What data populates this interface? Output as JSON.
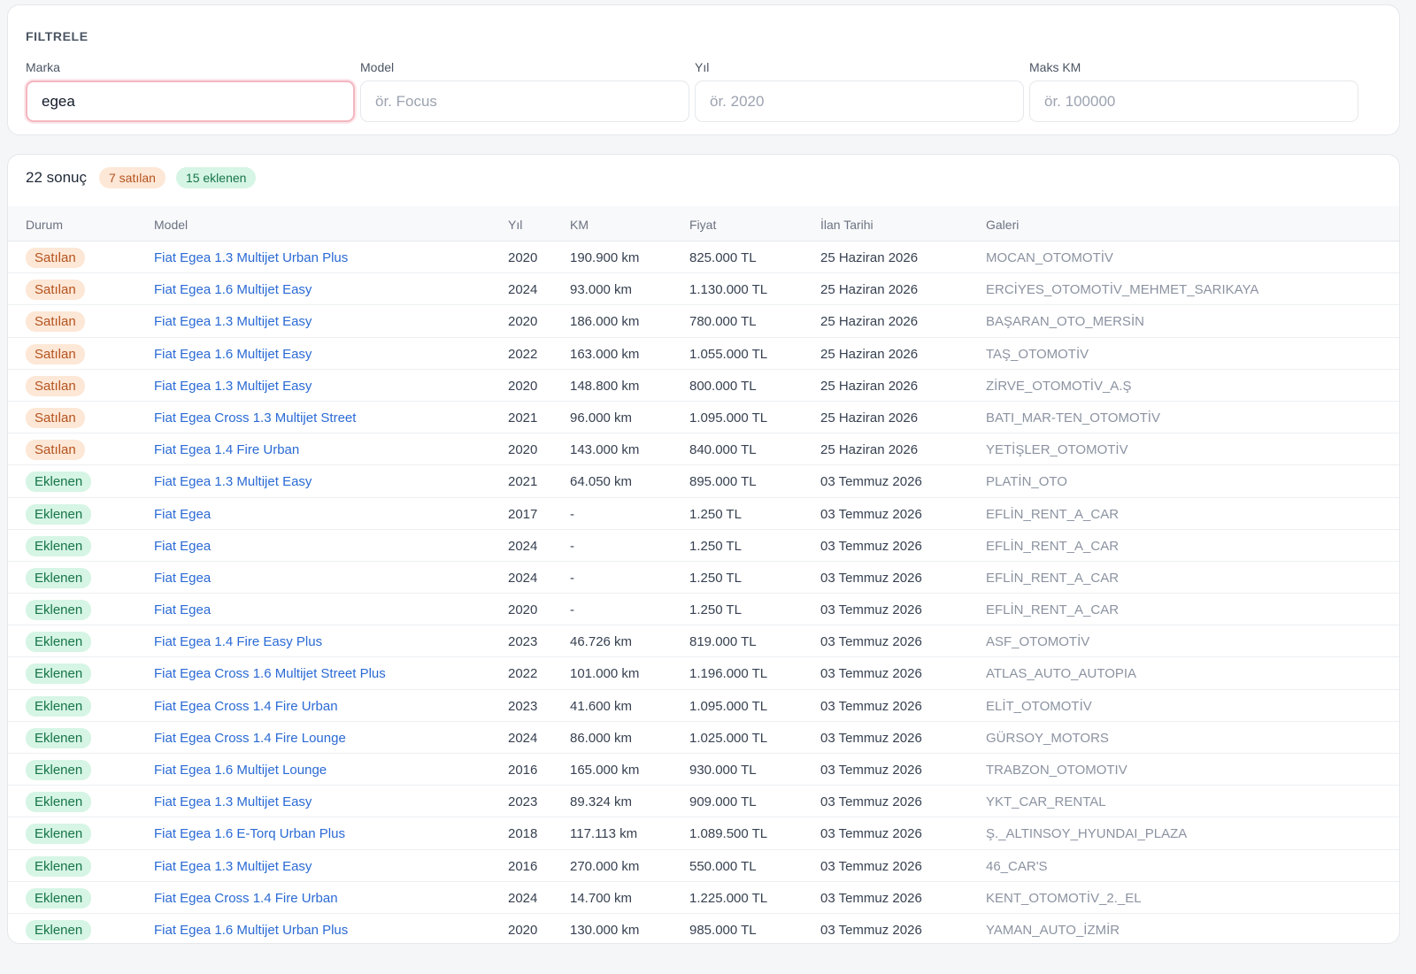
{
  "filter": {
    "title": "FILTRELE",
    "fields": [
      {
        "label": "Marka",
        "value": "egea",
        "placeholder": ""
      },
      {
        "label": "Model",
        "value": "",
        "placeholder": "ör. Focus"
      },
      {
        "label": "Yıl",
        "value": "",
        "placeholder": "ör. 2020"
      },
      {
        "label": "Maks KM",
        "value": "",
        "placeholder": "ör. 100000"
      }
    ]
  },
  "summary": {
    "count": "22 sonuç",
    "sold": "7 satılan",
    "added": "15 eklenen"
  },
  "columns": [
    "Durum",
    "Model",
    "Yıl",
    "KM",
    "Fiyat",
    "İlan Tarihi",
    "Galeri"
  ],
  "colors": {
    "link": "#2a6ad4",
    "sold_bg": "#fde7d6",
    "sold_text": "#b4531f",
    "added_bg": "#d6f5e5",
    "added_text": "#177548"
  },
  "rows": [
    {
      "status": "Satılan",
      "model": "Fiat Egea 1.3 Multijet Urban Plus",
      "year": "2020",
      "km": "190.900 km",
      "price": "825.000 TL",
      "date": "25 Haziran 2026",
      "gallery": "MOCAN_OTOMOTİV"
    },
    {
      "status": "Satılan",
      "model": "Fiat Egea 1.6 Multijet Easy",
      "year": "2024",
      "km": "93.000 km",
      "price": "1.130.000 TL",
      "date": "25 Haziran 2026",
      "gallery": "ERCİYES_OTOMOTİV_MEHMET_SARIKAYA"
    },
    {
      "status": "Satılan",
      "model": "Fiat Egea 1.3 Multijet Easy",
      "year": "2020",
      "km": "186.000 km",
      "price": "780.000 TL",
      "date": "25 Haziran 2026",
      "gallery": "BAŞARAN_OTO_MERSİN"
    },
    {
      "status": "Satılan",
      "model": "Fiat Egea 1.6 Multijet Easy",
      "year": "2022",
      "km": "163.000 km",
      "price": "1.055.000 TL",
      "date": "25 Haziran 2026",
      "gallery": "TAŞ_OTOMOTİV"
    },
    {
      "status": "Satılan",
      "model": "Fiat Egea 1.3 Multijet Easy",
      "year": "2020",
      "km": "148.800 km",
      "price": "800.000 TL",
      "date": "25 Haziran 2026",
      "gallery": "ZİRVE_OTOMOTİV_A.Ş"
    },
    {
      "status": "Satılan",
      "model": "Fiat Egea Cross 1.3 Multijet Street",
      "year": "2021",
      "km": "96.000 km",
      "price": "1.095.000 TL",
      "date": "25 Haziran 2026",
      "gallery": "BATI_MAR-TEN_OTOMOTİV"
    },
    {
      "status": "Satılan",
      "model": "Fiat Egea 1.4 Fire Urban",
      "year": "2020",
      "km": "143.000 km",
      "price": "840.000 TL",
      "date": "25 Haziran 2026",
      "gallery": "YETİŞLER_OTOMOTİV"
    },
    {
      "status": "Eklenen",
      "model": "Fiat Egea 1.3 Multijet Easy",
      "year": "2021",
      "km": "64.050 km",
      "price": "895.000 TL",
      "date": "03 Temmuz 2026",
      "gallery": "PLATİN_OTO"
    },
    {
      "status": "Eklenen",
      "model": "Fiat Egea",
      "year": "2017",
      "km": "-",
      "price": "1.250 TL",
      "date": "03 Temmuz 2026",
      "gallery": "EFLİN_RENT_A_CAR"
    },
    {
      "status": "Eklenen",
      "model": "Fiat Egea",
      "year": "2024",
      "km": "-",
      "price": "1.250 TL",
      "date": "03 Temmuz 2026",
      "gallery": "EFLİN_RENT_A_CAR"
    },
    {
      "status": "Eklenen",
      "model": "Fiat Egea",
      "year": "2024",
      "km": "-",
      "price": "1.250 TL",
      "date": "03 Temmuz 2026",
      "gallery": "EFLİN_RENT_A_CAR"
    },
    {
      "status": "Eklenen",
      "model": "Fiat Egea",
      "year": "2020",
      "km": "-",
      "price": "1.250 TL",
      "date": "03 Temmuz 2026",
      "gallery": "EFLİN_RENT_A_CAR"
    },
    {
      "status": "Eklenen",
      "model": "Fiat Egea 1.4 Fire Easy Plus",
      "year": "2023",
      "km": "46.726 km",
      "price": "819.000 TL",
      "date": "03 Temmuz 2026",
      "gallery": "ASF_OTOMOTİV"
    },
    {
      "status": "Eklenen",
      "model": "Fiat Egea Cross 1.6 Multijet Street Plus",
      "year": "2022",
      "km": "101.000 km",
      "price": "1.196.000 TL",
      "date": "03 Temmuz 2026",
      "gallery": "ATLAS_AUTO_AUTOPIA"
    },
    {
      "status": "Eklenen",
      "model": "Fiat Egea Cross 1.4 Fire Urban",
      "year": "2023",
      "km": "41.600 km",
      "price": "1.095.000 TL",
      "date": "03 Temmuz 2026",
      "gallery": "ELİT_OTOMOTİV"
    },
    {
      "status": "Eklenen",
      "model": "Fiat Egea Cross 1.4 Fire Lounge",
      "year": "2024",
      "km": "86.000 km",
      "price": "1.025.000 TL",
      "date": "03 Temmuz 2026",
      "gallery": "GÜRSOY_MOTORS"
    },
    {
      "status": "Eklenen",
      "model": "Fiat Egea 1.6 Multijet Lounge",
      "year": "2016",
      "km": "165.000 km",
      "price": "930.000 TL",
      "date": "03 Temmuz 2026",
      "gallery": "TRABZON_OTOMOTIV"
    },
    {
      "status": "Eklenen",
      "model": "Fiat Egea 1.3 Multijet Easy",
      "year": "2023",
      "km": "89.324 km",
      "price": "909.000 TL",
      "date": "03 Temmuz 2026",
      "gallery": "YKT_CAR_RENTAL"
    },
    {
      "status": "Eklenen",
      "model": "Fiat Egea 1.6 E-Torq Urban Plus",
      "year": "2018",
      "km": "117.113 km",
      "price": "1.089.500 TL",
      "date": "03 Temmuz 2026",
      "gallery": "Ş._ALTINSOY_HYUNDAI_PLAZA"
    },
    {
      "status": "Eklenen",
      "model": "Fiat Egea 1.3 Multijet Easy",
      "year": "2016",
      "km": "270.000 km",
      "price": "550.000 TL",
      "date": "03 Temmuz 2026",
      "gallery": "46_CAR'S"
    },
    {
      "status": "Eklenen",
      "model": "Fiat Egea Cross 1.4 Fire Urban",
      "year": "2024",
      "km": "14.700 km",
      "price": "1.225.000 TL",
      "date": "03 Temmuz 2026",
      "gallery": "KENT_OTOMOTİV_2._EL"
    },
    {
      "status": "Eklenen",
      "model": "Fiat Egea 1.6 Multijet Urban Plus",
      "year": "2020",
      "km": "130.000 km",
      "price": "985.000 TL",
      "date": "03 Temmuz 2026",
      "gallery": "YAMAN_AUTO_İZMİR"
    }
  ]
}
